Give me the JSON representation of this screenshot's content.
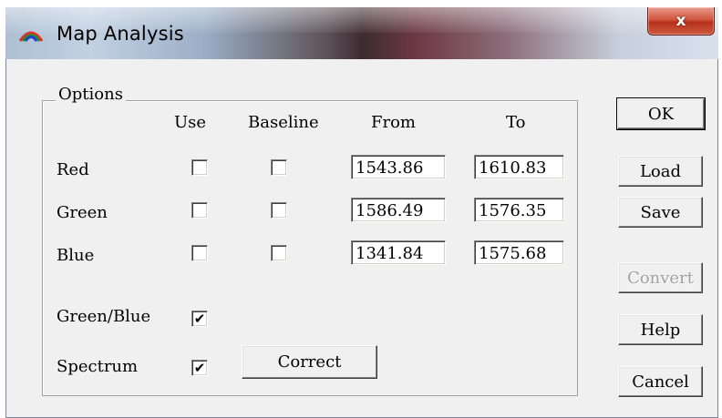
{
  "window": {
    "title": "Map Analysis",
    "close_label": "x"
  },
  "options": {
    "group_label": "Options",
    "headers": {
      "use": "Use",
      "baseline": "Baseline",
      "from": "From",
      "to": "To"
    },
    "channels": [
      {
        "label": "Red",
        "use": false,
        "baseline": false,
        "from": "1543.86",
        "to": "1610.83"
      },
      {
        "label": "Green",
        "use": false,
        "baseline": false,
        "from": "1586.49",
        "to": "1576.35"
      },
      {
        "label": "Blue",
        "use": false,
        "baseline": false,
        "from": "1341.84",
        "to": "1575.68"
      }
    ],
    "green_blue": {
      "label": "Green/Blue",
      "checked": true
    },
    "spectrum": {
      "label": "Spectrum",
      "checked": true
    },
    "correct_label": "Correct"
  },
  "buttons": {
    "ok": "OK",
    "load": "Load",
    "save": "Save",
    "convert": "Convert",
    "help": "Help",
    "cancel": "Cancel"
  },
  "colors": {
    "dialog_bg": "#f0f0f0",
    "close_red": "#c8412b",
    "disabled_text": "#a0a0a0"
  },
  "icons": {
    "app": "rainbow-arc-icon",
    "close": "close-icon",
    "check": "checkmark-icon"
  }
}
